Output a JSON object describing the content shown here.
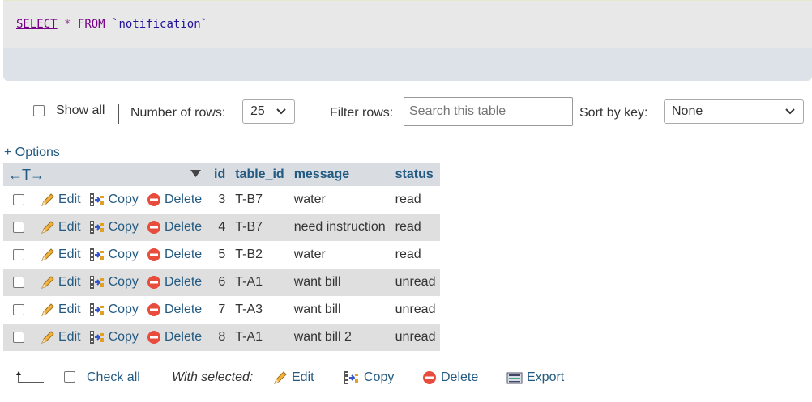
{
  "sql": {
    "select": "SELECT",
    "star": "*",
    "from": "FROM",
    "table": "`notification`"
  },
  "nav": {
    "show_all": "Show all",
    "number_of_rows_label": "Number of rows:",
    "rows_value": "25",
    "filter_label": "Filter rows:",
    "search_placeholder": "Search this table",
    "sort_label": "Sort by key:",
    "sort_value": "None"
  },
  "options_link": "+ Options",
  "columns": [
    "id",
    "table_id",
    "message",
    "status"
  ],
  "row_actions": {
    "edit": "Edit",
    "copy": "Copy",
    "delete": "Delete"
  },
  "rows": [
    {
      "id": "3",
      "table_id": "T-B7",
      "message": "water",
      "status": "read"
    },
    {
      "id": "4",
      "table_id": "T-B7",
      "message": "need instruction",
      "status": "read"
    },
    {
      "id": "5",
      "table_id": "T-B2",
      "message": "water",
      "status": "read"
    },
    {
      "id": "6",
      "table_id": "T-A1",
      "message": "want bill",
      "status": "unread"
    },
    {
      "id": "7",
      "table_id": "T-A3",
      "message": "want bill",
      "status": "unread"
    },
    {
      "id": "8",
      "table_id": "T-A1",
      "message": "want bill 2",
      "status": "unread"
    }
  ],
  "bottom": {
    "check_all": "Check all",
    "with_selected": "With selected:",
    "edit": "Edit",
    "copy": "Copy",
    "delete": "Delete",
    "export": "Export"
  },
  "colors": {
    "link": "#235a81",
    "header_bg": "#d9dde2",
    "even_row_bg": "#dfdfdf",
    "sql_bg": "#e8e8e8",
    "delete_red": "#e74c3c"
  }
}
